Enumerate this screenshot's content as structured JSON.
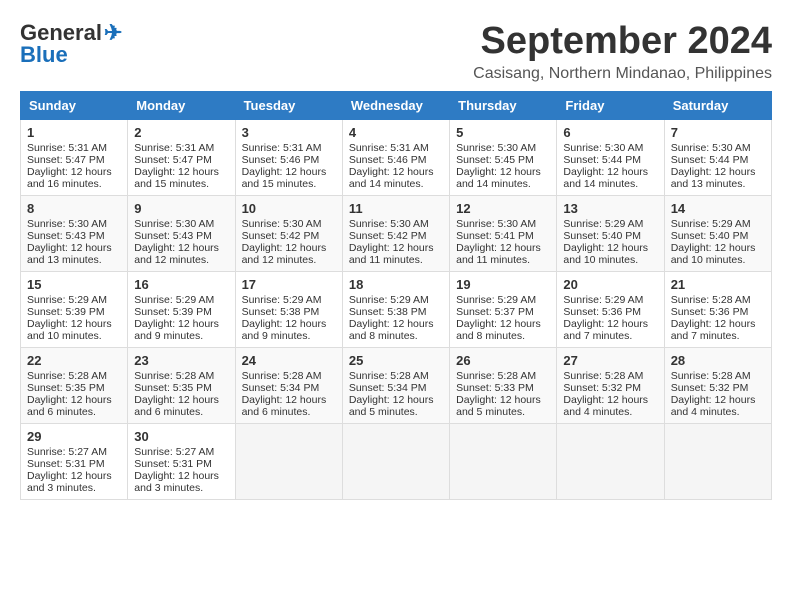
{
  "header": {
    "logo_general": "General",
    "logo_blue": "Blue",
    "month_title": "September 2024",
    "location": "Casisang, Northern Mindanao, Philippines"
  },
  "weekdays": [
    "Sunday",
    "Monday",
    "Tuesday",
    "Wednesday",
    "Thursday",
    "Friday",
    "Saturday"
  ],
  "weeks": [
    [
      {
        "day": "1",
        "lines": [
          "Sunrise: 5:31 AM",
          "Sunset: 5:47 PM",
          "Daylight: 12 hours",
          "and 16 minutes."
        ]
      },
      {
        "day": "2",
        "lines": [
          "Sunrise: 5:31 AM",
          "Sunset: 5:47 PM",
          "Daylight: 12 hours",
          "and 15 minutes."
        ]
      },
      {
        "day": "3",
        "lines": [
          "Sunrise: 5:31 AM",
          "Sunset: 5:46 PM",
          "Daylight: 12 hours",
          "and 15 minutes."
        ]
      },
      {
        "day": "4",
        "lines": [
          "Sunrise: 5:31 AM",
          "Sunset: 5:46 PM",
          "Daylight: 12 hours",
          "and 14 minutes."
        ]
      },
      {
        "day": "5",
        "lines": [
          "Sunrise: 5:30 AM",
          "Sunset: 5:45 PM",
          "Daylight: 12 hours",
          "and 14 minutes."
        ]
      },
      {
        "day": "6",
        "lines": [
          "Sunrise: 5:30 AM",
          "Sunset: 5:44 PM",
          "Daylight: 12 hours",
          "and 14 minutes."
        ]
      },
      {
        "day": "7",
        "lines": [
          "Sunrise: 5:30 AM",
          "Sunset: 5:44 PM",
          "Daylight: 12 hours",
          "and 13 minutes."
        ]
      }
    ],
    [
      {
        "day": "8",
        "lines": [
          "Sunrise: 5:30 AM",
          "Sunset: 5:43 PM",
          "Daylight: 12 hours",
          "and 13 minutes."
        ]
      },
      {
        "day": "9",
        "lines": [
          "Sunrise: 5:30 AM",
          "Sunset: 5:43 PM",
          "Daylight: 12 hours",
          "and 12 minutes."
        ]
      },
      {
        "day": "10",
        "lines": [
          "Sunrise: 5:30 AM",
          "Sunset: 5:42 PM",
          "Daylight: 12 hours",
          "and 12 minutes."
        ]
      },
      {
        "day": "11",
        "lines": [
          "Sunrise: 5:30 AM",
          "Sunset: 5:42 PM",
          "Daylight: 12 hours",
          "and 11 minutes."
        ]
      },
      {
        "day": "12",
        "lines": [
          "Sunrise: 5:30 AM",
          "Sunset: 5:41 PM",
          "Daylight: 12 hours",
          "and 11 minutes."
        ]
      },
      {
        "day": "13",
        "lines": [
          "Sunrise: 5:29 AM",
          "Sunset: 5:40 PM",
          "Daylight: 12 hours",
          "and 10 minutes."
        ]
      },
      {
        "day": "14",
        "lines": [
          "Sunrise: 5:29 AM",
          "Sunset: 5:40 PM",
          "Daylight: 12 hours",
          "and 10 minutes."
        ]
      }
    ],
    [
      {
        "day": "15",
        "lines": [
          "Sunrise: 5:29 AM",
          "Sunset: 5:39 PM",
          "Daylight: 12 hours",
          "and 10 minutes."
        ]
      },
      {
        "day": "16",
        "lines": [
          "Sunrise: 5:29 AM",
          "Sunset: 5:39 PM",
          "Daylight: 12 hours",
          "and 9 minutes."
        ]
      },
      {
        "day": "17",
        "lines": [
          "Sunrise: 5:29 AM",
          "Sunset: 5:38 PM",
          "Daylight: 12 hours",
          "and 9 minutes."
        ]
      },
      {
        "day": "18",
        "lines": [
          "Sunrise: 5:29 AM",
          "Sunset: 5:38 PM",
          "Daylight: 12 hours",
          "and 8 minutes."
        ]
      },
      {
        "day": "19",
        "lines": [
          "Sunrise: 5:29 AM",
          "Sunset: 5:37 PM",
          "Daylight: 12 hours",
          "and 8 minutes."
        ]
      },
      {
        "day": "20",
        "lines": [
          "Sunrise: 5:29 AM",
          "Sunset: 5:36 PM",
          "Daylight: 12 hours",
          "and 7 minutes."
        ]
      },
      {
        "day": "21",
        "lines": [
          "Sunrise: 5:28 AM",
          "Sunset: 5:36 PM",
          "Daylight: 12 hours",
          "and 7 minutes."
        ]
      }
    ],
    [
      {
        "day": "22",
        "lines": [
          "Sunrise: 5:28 AM",
          "Sunset: 5:35 PM",
          "Daylight: 12 hours",
          "and 6 minutes."
        ]
      },
      {
        "day": "23",
        "lines": [
          "Sunrise: 5:28 AM",
          "Sunset: 5:35 PM",
          "Daylight: 12 hours",
          "and 6 minutes."
        ]
      },
      {
        "day": "24",
        "lines": [
          "Sunrise: 5:28 AM",
          "Sunset: 5:34 PM",
          "Daylight: 12 hours",
          "and 6 minutes."
        ]
      },
      {
        "day": "25",
        "lines": [
          "Sunrise: 5:28 AM",
          "Sunset: 5:34 PM",
          "Daylight: 12 hours",
          "and 5 minutes."
        ]
      },
      {
        "day": "26",
        "lines": [
          "Sunrise: 5:28 AM",
          "Sunset: 5:33 PM",
          "Daylight: 12 hours",
          "and 5 minutes."
        ]
      },
      {
        "day": "27",
        "lines": [
          "Sunrise: 5:28 AM",
          "Sunset: 5:32 PM",
          "Daylight: 12 hours",
          "and 4 minutes."
        ]
      },
      {
        "day": "28",
        "lines": [
          "Sunrise: 5:28 AM",
          "Sunset: 5:32 PM",
          "Daylight: 12 hours",
          "and 4 minutes."
        ]
      }
    ],
    [
      {
        "day": "29",
        "lines": [
          "Sunrise: 5:27 AM",
          "Sunset: 5:31 PM",
          "Daylight: 12 hours",
          "and 3 minutes."
        ]
      },
      {
        "day": "30",
        "lines": [
          "Sunrise: 5:27 AM",
          "Sunset: 5:31 PM",
          "Daylight: 12 hours",
          "and 3 minutes."
        ]
      },
      {
        "day": "",
        "lines": []
      },
      {
        "day": "",
        "lines": []
      },
      {
        "day": "",
        "lines": []
      },
      {
        "day": "",
        "lines": []
      },
      {
        "day": "",
        "lines": []
      }
    ]
  ]
}
